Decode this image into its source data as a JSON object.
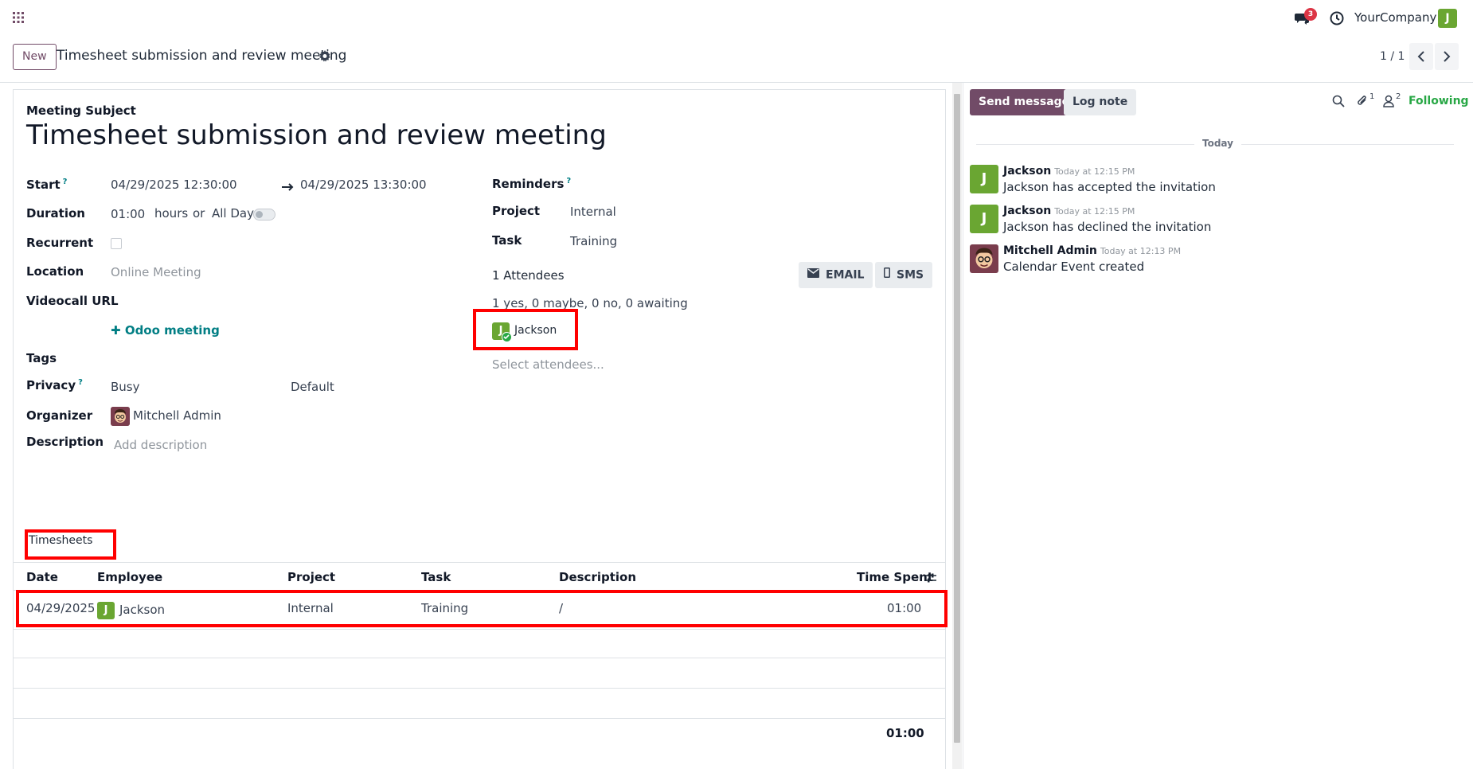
{
  "topbar": {
    "company": "YourCompany",
    "messages_badge": "3",
    "user_initial": "J"
  },
  "control": {
    "new_label": "New",
    "breadcrumb": "Timesheet submission and review meeting",
    "pager": "1 / 1"
  },
  "form": {
    "subject_label": "Meeting Subject",
    "subject": "Timesheet submission and review meeting",
    "start_label": "Start",
    "start_from": "04/29/2025 12:30:00",
    "start_to": "04/29/2025 13:30:00",
    "duration_label": "Duration",
    "duration": "01:00",
    "hours_label": "hours",
    "or_label": "or",
    "allday_label": "All Day",
    "recurrent_label": "Recurrent",
    "location_label": "Location",
    "location": "Online Meeting",
    "videocall_label": "Videocall URL",
    "odoo_meeting": "Odoo meeting",
    "tags_label": "Tags",
    "privacy_label": "Privacy",
    "privacy_show_as": "Busy",
    "privacy_value": "Default",
    "organizer_label": "Organizer",
    "organizer": "Mitchell Admin",
    "description_label": "Description",
    "description_placeholder": "Add description",
    "reminders_label": "Reminders",
    "project_label": "Project",
    "project": "Internal",
    "task_label": "Task",
    "task": "Training",
    "attendees_count": "1 Attendees",
    "email_label": "EMAIL",
    "sms_label": "SMS",
    "attendees_summary": "1 yes, 0 maybe, 0 no, 0 awaiting",
    "attendee_name": "Jackson",
    "attendee_initial": "J",
    "select_attendees": "Select attendees..."
  },
  "timesheets": {
    "tab_label": "Timesheets",
    "headers": {
      "date": "Date",
      "employee": "Employee",
      "project": "Project",
      "task": "Task",
      "description": "Description",
      "time_spent": "Time Spent"
    },
    "rows": [
      {
        "date": "04/29/2025",
        "employee_initial": "J",
        "employee": "Jackson",
        "project": "Internal",
        "task": "Training",
        "description": "/",
        "time_spent": "01:00"
      }
    ],
    "total": "01:00"
  },
  "chatter": {
    "send_message": "Send message",
    "log_note": "Log note",
    "attachments_count": "1",
    "followers_count": "2",
    "following_label": "Following",
    "day_label": "Today",
    "messages": [
      {
        "author": "Jackson",
        "time": "Today at 12:15 PM",
        "body": "Jackson has accepted the invitation",
        "initial": "J"
      },
      {
        "author": "Jackson",
        "time": "Today at 12:15 PM",
        "body": "Jackson has declined the invitation",
        "initial": "J"
      },
      {
        "author": "Mitchell Admin",
        "time": "Today at 12:13 PM",
        "body": "Calendar Event created",
        "initial": ""
      }
    ]
  },
  "colors": {
    "brand": "#714B67",
    "accent": "#017e84",
    "avatar_green": "#6aa632",
    "highlight_red": "#ff0000",
    "following_green": "#28a745"
  }
}
